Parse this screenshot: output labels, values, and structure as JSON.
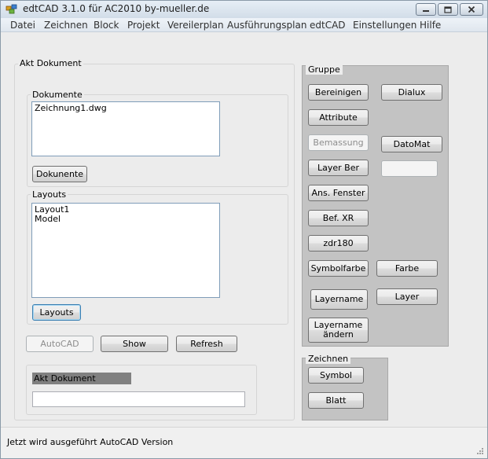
{
  "window": {
    "title": "edtCAD 3.1.0 für AC2010   by-mueller.de"
  },
  "menu": [
    "Datei",
    "Zeichnen",
    "Block",
    "Projekt",
    "Vereilerplan",
    "Ausführungsplan",
    "edtCAD",
    "Einstellungen",
    "Hilfe"
  ],
  "left": {
    "akt_group_label": "Akt Dokument",
    "dokumente_label": "Dokumente",
    "dokumente_items": [
      "Zeichnung1.dwg"
    ],
    "dokumente_button": "Dokunente",
    "layouts_label": "Layouts",
    "layouts_items": [
      "Layout1",
      "Model"
    ],
    "layouts_button": "Layouts",
    "autocad_button": "AutoCAD",
    "show_button": "Show",
    "refresh_button": "Refresh",
    "akt_dokument_label": "Akt Dokument",
    "akt_dokument_value": ""
  },
  "gruppe": {
    "label": "Gruppe",
    "bereinigen": "Bereinigen",
    "dialux": "Dialux",
    "attribute": "Attribute",
    "bemassung": "Bemassung",
    "datomat": "DatoMat",
    "layer_ber": "Layer Ber",
    "blank": "",
    "ans_fenster": "Ans. Fenster",
    "bef_xr": "Bef. XR",
    "zdr180": "zdr180",
    "symbolfarbe": "Symbolfarbe",
    "farbe": "Farbe",
    "layername": "Layername",
    "layer": "Layer",
    "layername_aendern_1": "Layername",
    "layername_aendern_2": "ändern"
  },
  "zeichnen": {
    "label": "Zeichnen",
    "symbol": "Symbol",
    "blatt": "Blatt"
  },
  "status": {
    "text": "Jetzt wird ausgeführt AutoCAD Version"
  }
}
